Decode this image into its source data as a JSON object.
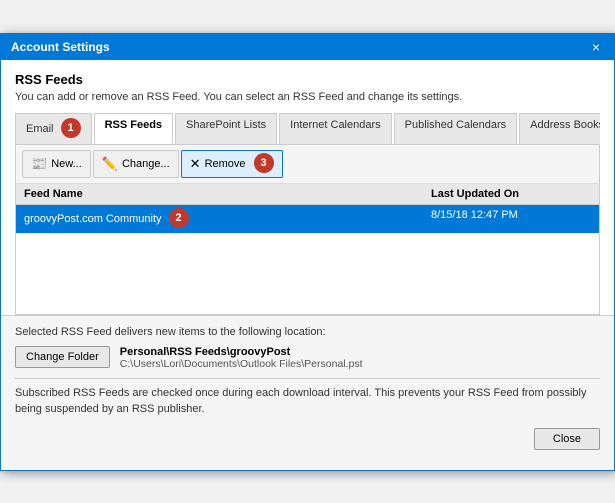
{
  "window": {
    "title": "Account Settings",
    "close_label": "×"
  },
  "header": {
    "section_title": "RSS Feeds",
    "section_desc": "You can add or remove an RSS Feed. You can select an RSS Feed and change its settings."
  },
  "tabs": [
    {
      "id": "email",
      "label": "Email"
    },
    {
      "id": "rss",
      "label": "RSS Feeds",
      "active": true
    },
    {
      "id": "sharepoint",
      "label": "SharePoint Lists"
    },
    {
      "id": "internet",
      "label": "Internet Calendars"
    },
    {
      "id": "published",
      "label": "Published Calendars"
    },
    {
      "id": "address",
      "label": "Address Books"
    }
  ],
  "toolbar": {
    "new_label": "New...",
    "change_label": "Change...",
    "remove_label": "Remove"
  },
  "table": {
    "col_name": "Feed Name",
    "col_updated": "Last Updated On",
    "rows": [
      {
        "name": "groovyPost.com Community",
        "updated": "8/15/18 12:47 PM",
        "selected": true
      }
    ]
  },
  "bottom": {
    "info_label": "Selected RSS Feed delivers new items to the following location:",
    "change_folder_label": "Change Folder",
    "folder_path": "Personal\\RSS Feeds\\groovyPost",
    "file_path": "C:\\Users\\Lori\\Documents\\Outlook Files\\Personal.pst",
    "note": "Subscribed RSS Feeds are checked once during each download interval. This prevents your RSS Feed from possibly being suspended by an RSS publisher.",
    "close_label": "Close"
  }
}
